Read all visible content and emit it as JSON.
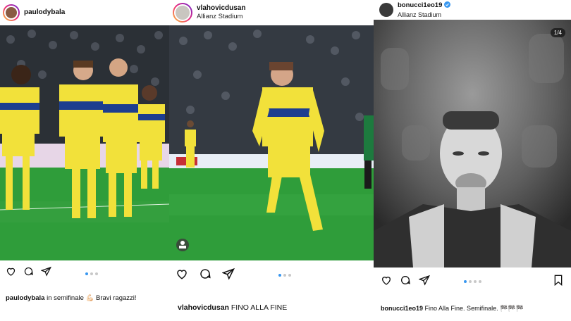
{
  "posts": [
    {
      "username": "paulodybala",
      "location": "",
      "caption_user": "paulodybala",
      "caption_text": " in semifinale 💪🏻 Bravi ragazzi!",
      "carousel": {
        "count": 3,
        "active": 0
      }
    },
    {
      "username": "vlahovicdusan",
      "location": "Allianz Stadium",
      "caption_user": "vlahovicdusan",
      "caption_text": " FINO ALLA FINE",
      "carousel": {
        "count": 3,
        "active": 0
      }
    },
    {
      "username": "bonucci1eo19",
      "location": "Allianz Stadium",
      "verified": true,
      "caption_user": "bonucci1eo19",
      "caption_text": " Fino Alla Fine. Semifinale. 🏁🏁🏁",
      "carousel": {
        "count": 4,
        "active": 0
      },
      "image_counter": "1/4"
    }
  ],
  "icons": [
    "heart-icon",
    "comment-icon",
    "share-icon",
    "bookmark-icon",
    "verified-icon",
    "tag-people-icon"
  ],
  "colors": {
    "accent": "#3897f0",
    "pitch": "#2f9d3a",
    "kit_yellow": "#f2e13a",
    "kit_blue": "#1d3e8f"
  }
}
